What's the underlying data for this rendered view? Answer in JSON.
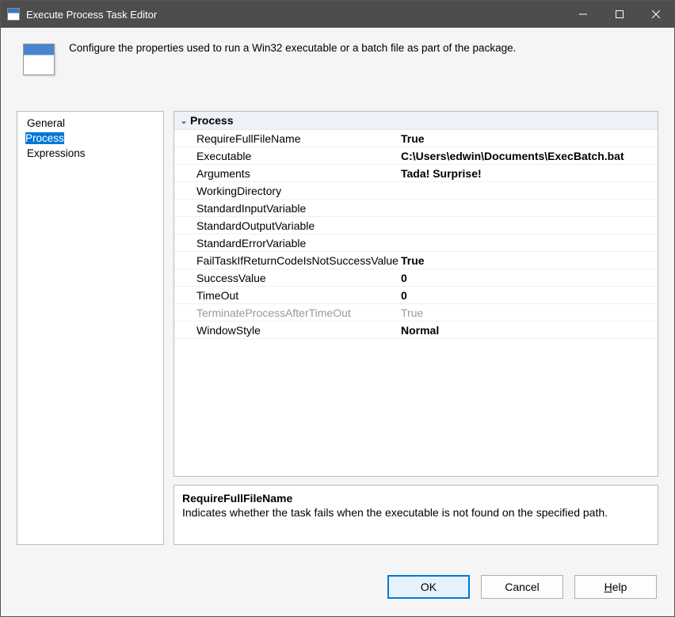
{
  "window": {
    "title": "Execute Process Task Editor"
  },
  "header": {
    "description": "Configure the properties used to run a Win32 executable or a batch file as part of the package."
  },
  "sidebar": {
    "items": [
      {
        "label": "General",
        "selected": false
      },
      {
        "label": "Process",
        "selected": true
      },
      {
        "label": "Expressions",
        "selected": false
      }
    ]
  },
  "propertyGrid": {
    "groupLabel": "Process",
    "rows": [
      {
        "name": "RequireFullFileName",
        "value": "True",
        "disabled": false
      },
      {
        "name": "Executable",
        "value": "C:\\Users\\edwin\\Documents\\ExecBatch.bat",
        "disabled": false
      },
      {
        "name": "Arguments",
        "value": "Tada! Surprise!",
        "disabled": false
      },
      {
        "name": "WorkingDirectory",
        "value": "",
        "disabled": false
      },
      {
        "name": "StandardInputVariable",
        "value": "",
        "disabled": false
      },
      {
        "name": "StandardOutputVariable",
        "value": "",
        "disabled": false
      },
      {
        "name": "StandardErrorVariable",
        "value": "",
        "disabled": false
      },
      {
        "name": "FailTaskIfReturnCodeIsNotSuccessValue",
        "value": "True",
        "disabled": false
      },
      {
        "name": "SuccessValue",
        "value": "0",
        "disabled": false
      },
      {
        "name": "TimeOut",
        "value": "0",
        "disabled": false
      },
      {
        "name": "TerminateProcessAfterTimeOut",
        "value": "True",
        "disabled": true
      },
      {
        "name": "WindowStyle",
        "value": "Normal",
        "disabled": false
      }
    ]
  },
  "descriptionPanel": {
    "title": "RequireFullFileName",
    "text": "Indicates whether the task fails when the executable is not found on the specified path."
  },
  "buttons": {
    "ok": "OK",
    "cancel": "Cancel",
    "help_prefix": "H",
    "help_rest": "elp"
  }
}
